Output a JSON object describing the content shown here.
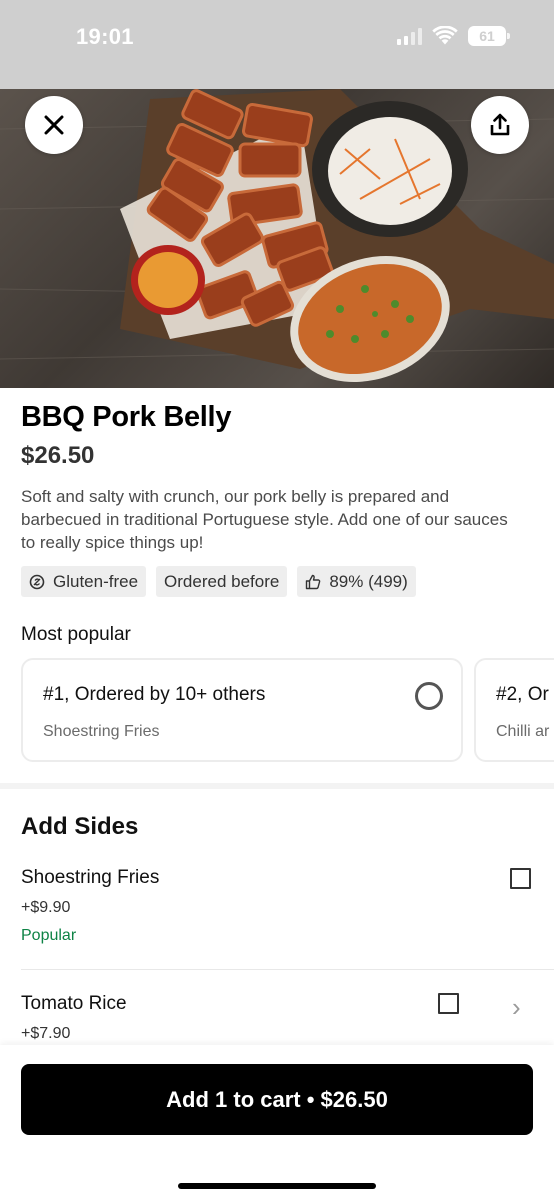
{
  "status": {
    "time": "19:01",
    "battery": "61"
  },
  "hero": {
    "image_alt": "BBQ pork belly platter with coleslaw, tomato rice and dipping sauce",
    "close_icon": "close-icon",
    "share_icon": "share-icon"
  },
  "item": {
    "title": "BBQ Pork Belly",
    "price": "$26.50",
    "description": "Soft and salty with crunch, our pork belly is prepared and barbecued in traditional Portuguese style. Add one of our sauces to really spice things up!",
    "tags": [
      {
        "label": "Gluten-free",
        "icon": "gluten-free-icon"
      },
      {
        "label": "Ordered before"
      },
      {
        "label": "89% (499)",
        "icon": "thumbs-up-icon"
      }
    ]
  },
  "most_popular": {
    "heading": "Most popular",
    "cards": [
      {
        "title": "#1, Ordered by 10+ others",
        "subtitle": "Shoestring Fries"
      },
      {
        "title": "#2, Or",
        "subtitle": "Chilli ar"
      }
    ]
  },
  "add_sides": {
    "heading": "Add Sides",
    "items": [
      {
        "name": "Shoestring Fries",
        "price": "+$9.90",
        "badge": "Popular"
      },
      {
        "name": "Tomato Rice",
        "price": "+$7.90"
      }
    ]
  },
  "cart": {
    "button_label": "Add 1 to cart • $26.50"
  },
  "colors": {
    "popular_badge": "#0e8345",
    "cart_button": "#000000"
  }
}
